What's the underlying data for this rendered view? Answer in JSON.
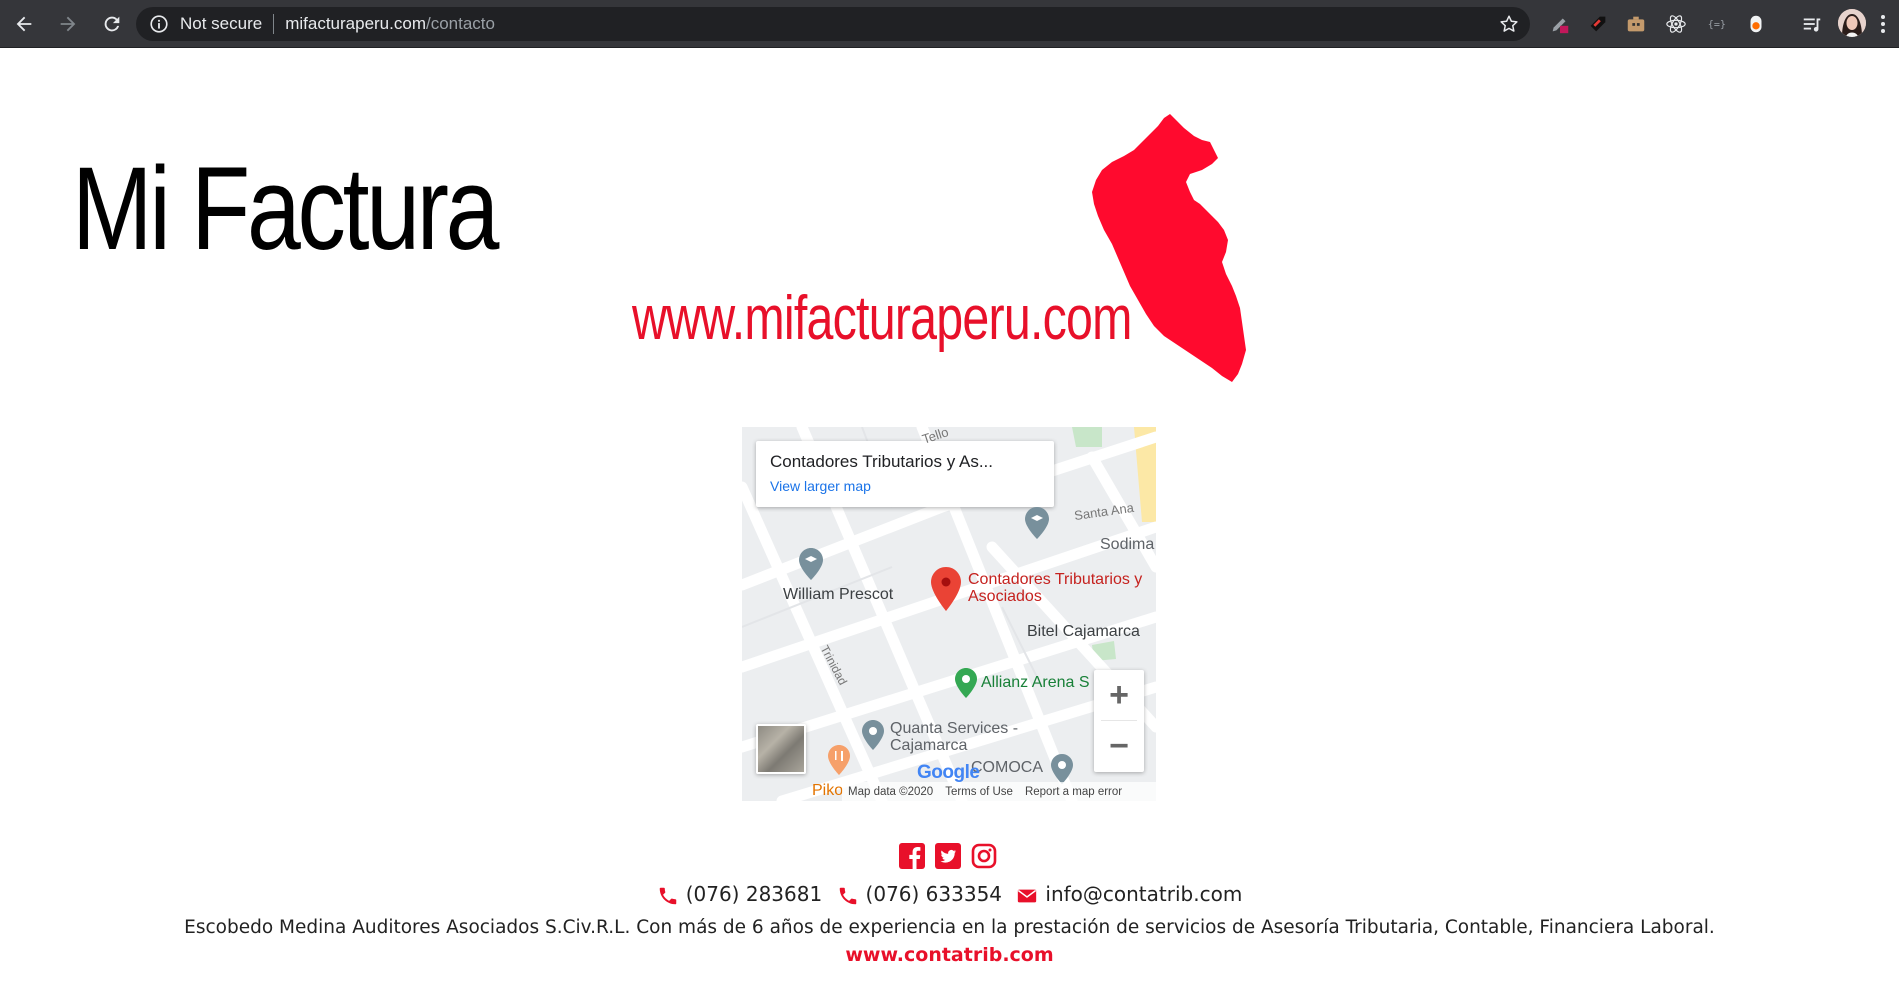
{
  "browser": {
    "security_label": "Not secure",
    "url_host": "mifacturaperu.com",
    "url_path": "/contacto"
  },
  "logo": {
    "title": "Mi Factura",
    "website": "www.mifacturaperu.com"
  },
  "map": {
    "card_title": "Contadores Tributarios y As...",
    "card_link": "View larger map",
    "places": {
      "main": "Contadores Tributarios y Asociados",
      "william": "William Prescot",
      "bitel": "Bitel Cajamarca",
      "allianz": "Allianz Arena S",
      "quanta": "Quanta Services - Cajamarca",
      "comoca": "COMOCA",
      "piko": "Piko",
      "sodima": "Sodima"
    },
    "streets": {
      "santa_ana": "Santa Ana",
      "trinidad": "Trinidad",
      "tello": "Tello"
    },
    "zoom_in": "+",
    "zoom_out": "−",
    "google": "Google",
    "map_data": "Map data ©2020",
    "terms": "Terms of Use",
    "report": "Report a map error"
  },
  "social": {
    "facebook": "facebook-icon",
    "twitter": "twitter-icon",
    "instagram": "instagram-icon"
  },
  "contact": {
    "phone1": "(076) 283681",
    "phone2": "(076) 633354",
    "email": "info@contatrib.com"
  },
  "about": "Escobedo Medina Auditores Asociados S.Civ.R.L. Con más de 6 años de experiencia en la prestación de servicios de Asesoría Tributaria, Contable, Financiera Laboral.",
  "site_link": "www.contatrib.com",
  "colors": {
    "brand_red": "#e8102a",
    "chrome_bg": "#35363a"
  }
}
